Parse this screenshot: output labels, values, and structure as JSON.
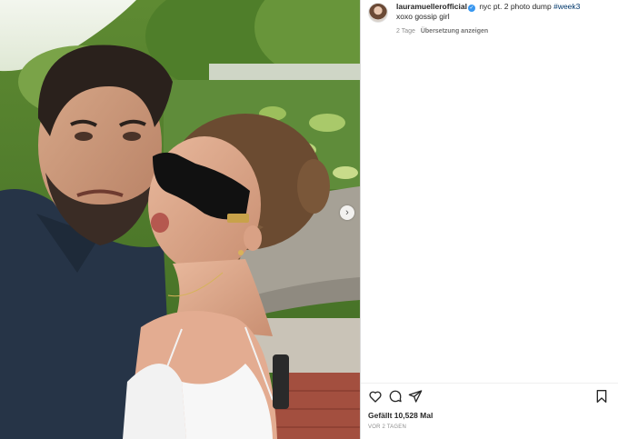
{
  "post": {
    "username": "lauramuellerofficial",
    "caption_text": "nyc pt. 2 photo dump",
    "hashtag": "#week3",
    "caption_line2": "xoxo gossip girl",
    "age": "2 Tage",
    "translate_label": "Übersetzung anzeigen",
    "likes_text": "Gefällt 10,528 Mal",
    "date_text": "VOR 2 TAGEN"
  },
  "photo": {
    "icons": {
      "next": "chevron-right-icon"
    }
  },
  "actions": {
    "icons": [
      "heart-icon",
      "comment-icon",
      "share-icon",
      "bookmark-icon"
    ]
  },
  "colors": {
    "link": "#00376b",
    "verified": "#3897f0",
    "muted": "#8e8e8e"
  }
}
